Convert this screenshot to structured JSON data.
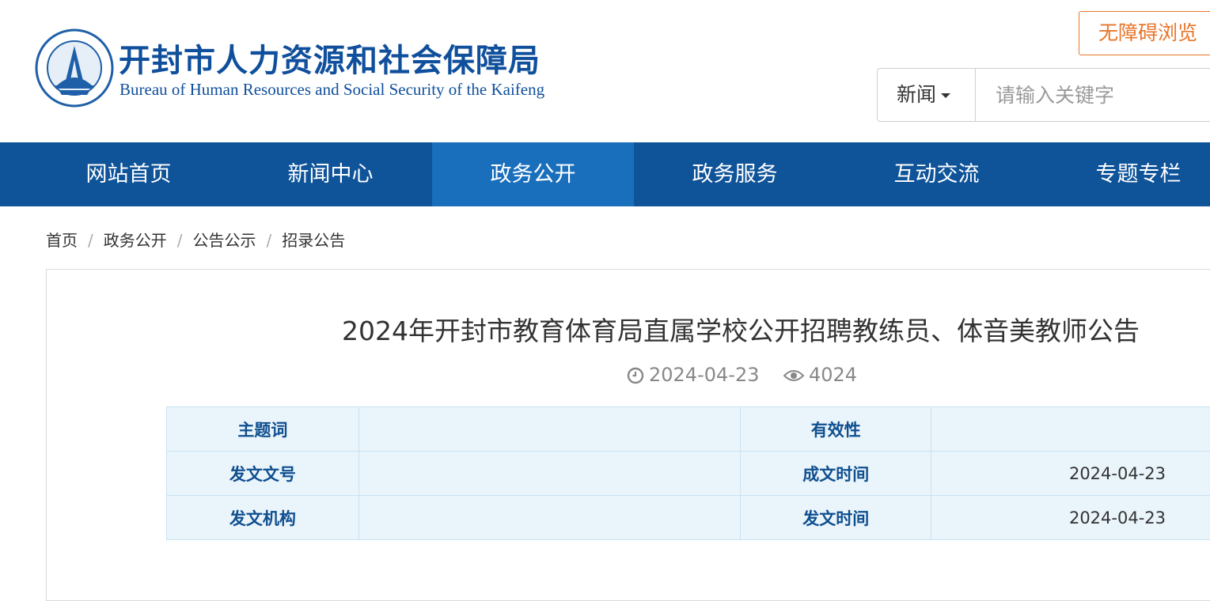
{
  "header": {
    "emblem_icon": "bureau-emblem-icon",
    "title_cn": "开封市人力资源和社会保障局",
    "title_en": "Bureau of Human Resources and Social Security of the Kaifeng",
    "accessibility_label": "无障碍浏览",
    "search": {
      "category": "新闻",
      "placeholder": "请输入关键字",
      "value": ""
    }
  },
  "nav": {
    "items": [
      {
        "label": "网站首页"
      },
      {
        "label": "新闻中心"
      },
      {
        "label": "政务公开",
        "active": true
      },
      {
        "label": "政务服务"
      },
      {
        "label": "互动交流"
      },
      {
        "label": "专题专栏"
      }
    ]
  },
  "breadcrumb": [
    "首页",
    "政务公开",
    "公告公示",
    "招录公告"
  ],
  "article": {
    "title": "2024年开封市教育体育局直属学校公开招聘教练员、体音美教师公告",
    "date": "2024-04-23",
    "views": "4024",
    "info": {
      "subject_label": "主题词",
      "subject_value": "",
      "validity_label": "有效性",
      "validity_value": "",
      "doc_no_label": "发文文号",
      "doc_no_value": "",
      "created_label": "成文时间",
      "created_value": "2024-04-23",
      "issuer_label": "发文机构",
      "issuer_value": "",
      "issued_label": "发文时间",
      "issued_value": "2024-04-23"
    }
  },
  "colors": {
    "brand_blue": "#0f5399",
    "nav_active": "#1a6fbd",
    "accent_orange": "#e8762b",
    "table_bg": "#eaf4fb"
  }
}
